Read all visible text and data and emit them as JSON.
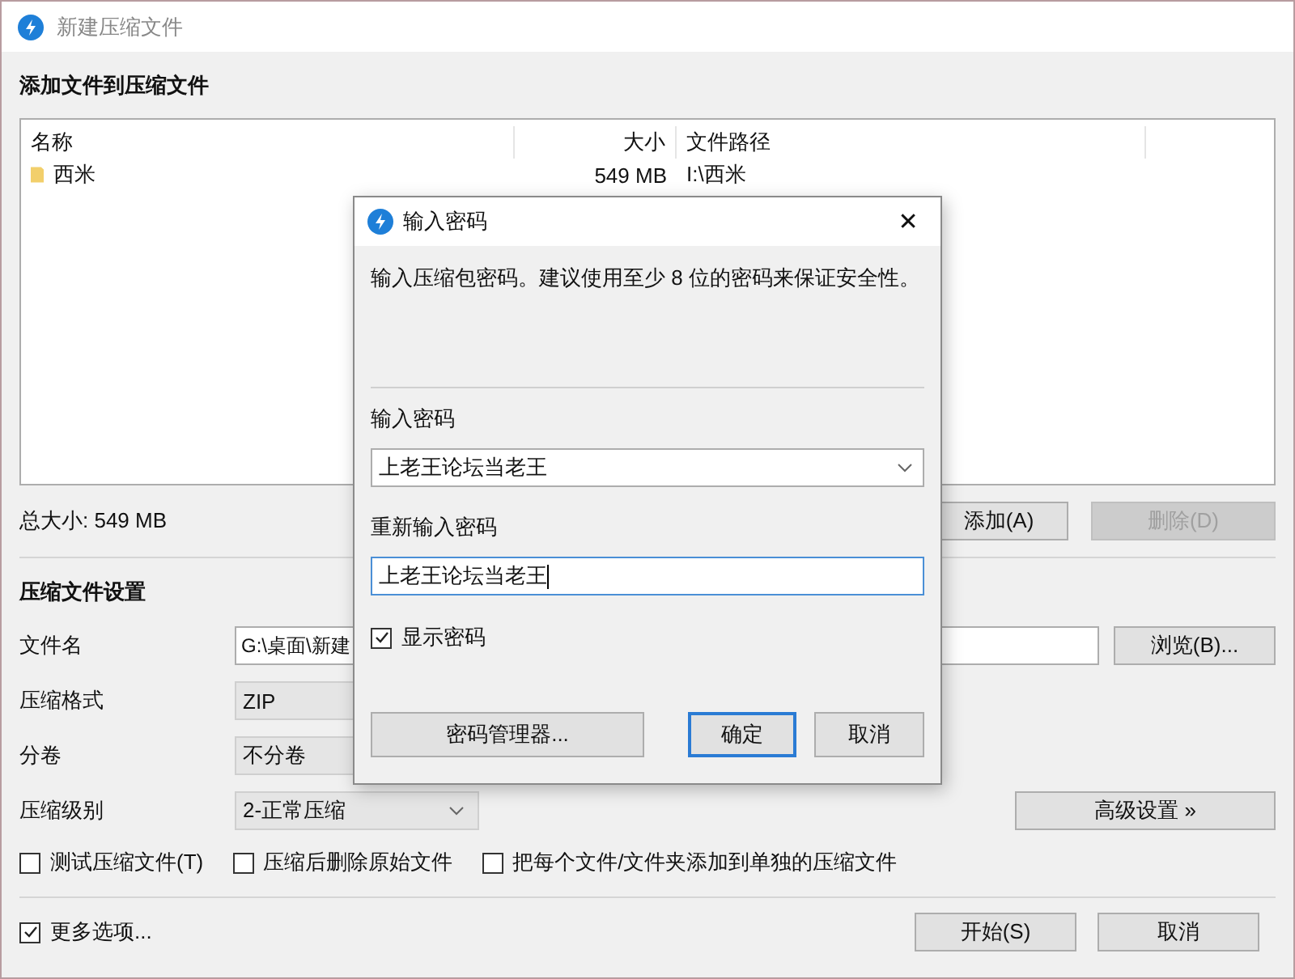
{
  "window": {
    "title": "新建压缩文件"
  },
  "files_section": {
    "title": "添加文件到压缩文件",
    "columns": [
      "名称",
      "大小",
      "文件路径"
    ],
    "rows": [
      {
        "kind": "folder",
        "name": "西米",
        "size": "549 MB",
        "path": "I:\\西米"
      }
    ],
    "total": "总大小: 549 MB",
    "buttons": [
      {
        "label": "添加(A)",
        "disabled": false
      },
      {
        "label": "删除(D)",
        "disabled": true
      }
    ]
  },
  "settings": {
    "title": "压缩文件设置",
    "file_name": {
      "label": "文件名",
      "value": "G:\\桌面\\新建"
    },
    "browse_button": "浏览(B)...",
    "format": {
      "label": "压缩格式",
      "value": "ZIP"
    },
    "split": {
      "label": "分卷",
      "value": "不分卷"
    },
    "level": {
      "label": "压缩级别",
      "value": "2-正常压缩"
    },
    "advanced_button": "高级设置 »",
    "options": [
      {
        "label": "测试压缩文件(T)",
        "checked": false
      },
      {
        "label": "压缩后删除原始文件",
        "checked": false
      },
      {
        "label": "把每个文件/文件夹添加到单独的压缩文件",
        "checked": false
      }
    ]
  },
  "more_options": {
    "label": "更多选项...",
    "checked": true
  },
  "footer_buttons": [
    "开始(S)",
    "取消"
  ],
  "dialog": {
    "title": "输入密码",
    "close": "✕",
    "message": "输入压缩包密码。建议使用至少 8 位的密码来保证安全性。",
    "password_label": "输入密码",
    "password_value": "上老王论坛当老王",
    "confirm_label": "重新输入密码",
    "confirm_value": "上老王论坛当老王",
    "show_password": {
      "label": "显示密码",
      "checked": true
    },
    "buttons": [
      {
        "label": "密码管理器...",
        "default": false
      },
      {
        "label": "确定",
        "default": true
      },
      {
        "label": "取消",
        "default": false
      }
    ]
  }
}
